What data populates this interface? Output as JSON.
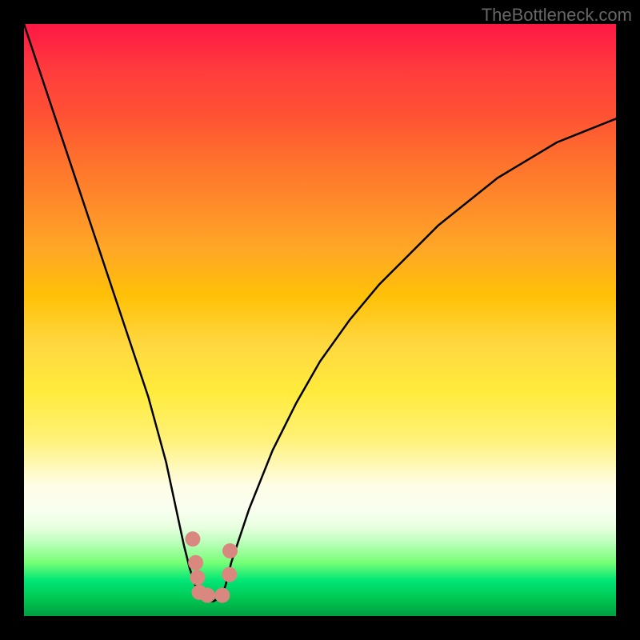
{
  "watermark": "TheBottleneck.com",
  "chart_data": {
    "type": "line",
    "title": "",
    "xlabel": "",
    "ylabel": "",
    "xlim": [
      0,
      100
    ],
    "ylim": [
      0,
      100
    ],
    "curve": {
      "x": [
        0,
        3,
        6,
        9,
        12,
        15,
        18,
        21,
        24,
        27,
        28,
        29,
        30,
        31,
        32,
        33,
        34,
        35,
        38,
        42,
        46,
        50,
        55,
        60,
        65,
        70,
        75,
        80,
        85,
        90,
        95,
        100
      ],
      "y": [
        100,
        91,
        82,
        73,
        64,
        55,
        46,
        37,
        26,
        12,
        8,
        5,
        3,
        2.5,
        2.5,
        3,
        5,
        9,
        18,
        28,
        36,
        43,
        50,
        56,
        61,
        66,
        70,
        74,
        77,
        80,
        82,
        84
      ]
    },
    "markers": [
      {
        "x": 28.5,
        "y": 13,
        "shape": "dot",
        "color": "#d98880",
        "size": 19
      },
      {
        "x": 34.8,
        "y": 11,
        "shape": "dot",
        "color": "#d98880",
        "size": 19
      },
      {
        "x": 29.0,
        "y": 9,
        "shape": "dot",
        "color": "#d98880",
        "size": 19
      },
      {
        "x": 29.3,
        "y": 6.5,
        "shape": "dot",
        "color": "#d98880",
        "size": 19
      },
      {
        "x": 29.6,
        "y": 4.0,
        "shape": "dot",
        "color": "#d98880",
        "size": 19
      },
      {
        "x": 31.0,
        "y": 3.5,
        "shape": "dot",
        "color": "#d98880",
        "size": 19
      },
      {
        "x": 33.5,
        "y": 3.5,
        "shape": "dot",
        "color": "#d98880",
        "size": 19
      },
      {
        "x": 34.7,
        "y": 7,
        "shape": "dot",
        "color": "#d98880",
        "size": 19
      }
    ],
    "gradient_stops": [
      {
        "pos": 0,
        "color": "#ff1744"
      },
      {
        "pos": 50,
        "color": "#ffeb3b"
      },
      {
        "pos": 100,
        "color": "#00a040"
      }
    ]
  }
}
